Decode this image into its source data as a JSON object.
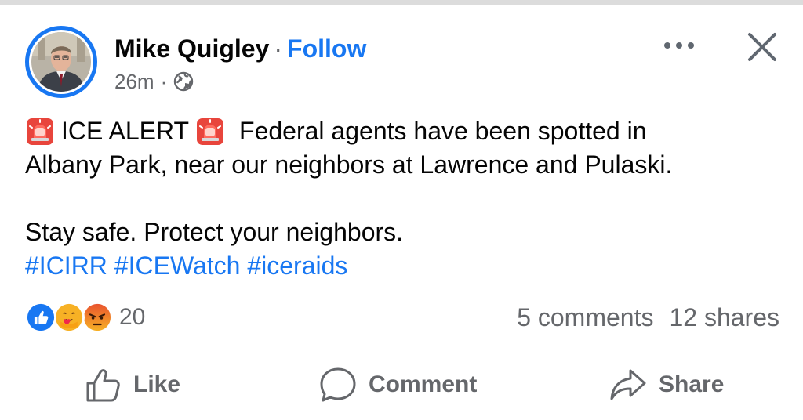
{
  "post": {
    "author": "Mike Quigley",
    "separator": "·",
    "follow_label": "Follow",
    "timestamp": "26m",
    "meta_separator": "·",
    "privacy_icon": "globe-icon",
    "lines": [
      "ICE ALERT",
      "Federal agents have been spotted in",
      "Albany Park, near our neighbors at Lawrence and Pulaski.",
      "Stay safe. Protect your neighbors."
    ],
    "emoji": "siren-emoji",
    "hashtags": [
      "#ICIRR",
      "#ICEWatch",
      "#iceraids"
    ]
  },
  "engagement": {
    "reaction_icons": [
      "like",
      "care",
      "angry"
    ],
    "reaction_count": "20",
    "comments": "5 comments",
    "shares": "12 shares"
  },
  "actions": {
    "like": "Like",
    "comment": "Comment",
    "share": "Share"
  },
  "colors": {
    "brand_blue": "#1877f2",
    "secondary_text": "#65676b",
    "primary_text": "#050505"
  }
}
